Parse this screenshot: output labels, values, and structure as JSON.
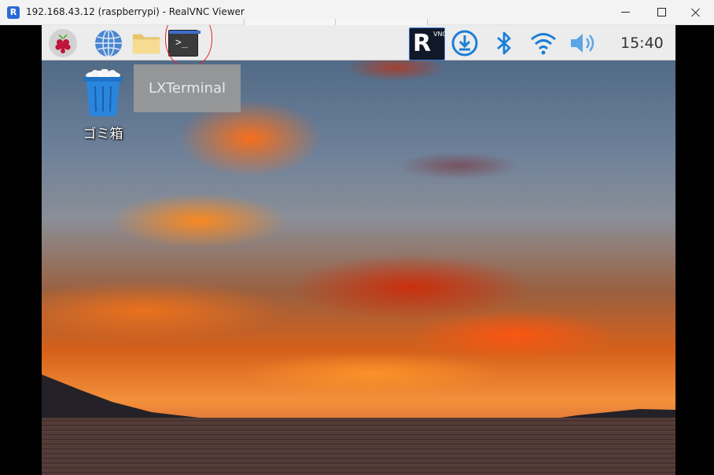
{
  "window": {
    "title": "192.168.43.12 (raspberrypi) - RealVNC Viewer",
    "app_icon": "realvnc-viewer-icon",
    "controls": [
      "minimize",
      "maximize",
      "close"
    ]
  },
  "taskbar": {
    "items": [
      {
        "name": "raspberry-pi-menu",
        "icon": "raspberry-icon"
      },
      {
        "name": "web-browser",
        "icon": "globe-icon"
      },
      {
        "name": "file-manager",
        "icon": "folder-icon"
      },
      {
        "name": "lxterminal",
        "icon": "terminal-icon",
        "prompt": ">_",
        "highlighted": true
      }
    ],
    "tray": {
      "vnc_logo_letter": "R",
      "vnc_logo_text": "VNC",
      "icons": [
        "vnc-server-icon",
        "download-updates-icon",
        "bluetooth-icon",
        "wifi-icon",
        "volume-icon"
      ],
      "clock": "15:40"
    }
  },
  "tooltip": {
    "text": "LXTerminal"
  },
  "desktop": {
    "icons": [
      {
        "label": "ゴミ箱",
        "icon": "trash-icon"
      }
    ]
  },
  "colors": {
    "accent_blue": "#1a7fd6",
    "annotation_red": "#e02828",
    "taskbar_bg": "#ececec"
  }
}
